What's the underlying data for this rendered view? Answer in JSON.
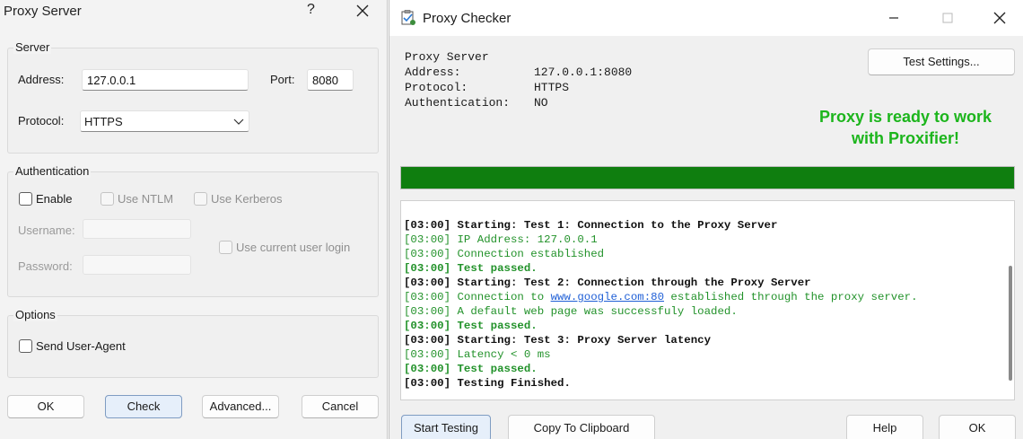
{
  "proxy_dialog": {
    "title": "Proxy Server",
    "help_glyph": "?",
    "server": {
      "legend": "Server",
      "address_label": "Address:",
      "address_value": "127.0.0.1",
      "port_label": "Port:",
      "port_value": "8080",
      "protocol_label": "Protocol:",
      "protocol_value": "HTTPS"
    },
    "authentication": {
      "legend": "Authentication",
      "enable_label": "Enable",
      "use_ntlm_label": "Use NTLM",
      "use_kerberos_label": "Use Kerberos",
      "username_label": "Username:",
      "password_label": "Password:",
      "use_current_user_label": "Use current user login"
    },
    "options": {
      "legend": "Options",
      "send_user_agent_label": "Send User-Agent"
    },
    "buttons": {
      "ok": "OK",
      "check": "Check",
      "advanced": "Advanced...",
      "cancel": "Cancel"
    }
  },
  "checker": {
    "title": "Proxy Checker",
    "info": {
      "heading": "Proxy Server",
      "address_label": "Address:",
      "address_value": "127.0.0.1:8080",
      "protocol_label": "Protocol:",
      "protocol_value": "HTTPS",
      "auth_label": "Authentication:",
      "auth_value": "NO"
    },
    "test_settings_label": "Test Settings...",
    "status_line1": "Proxy is ready to work",
    "status_line2": "with Proxifier!",
    "progress_percent": 100,
    "log": [
      {
        "text": "[03:00] Starting: Test 1: Connection to the Proxy Server",
        "style": "bold"
      },
      {
        "text": "[03:00] IP Address: 127.0.0.1",
        "style": "ok"
      },
      {
        "text": "[03:00] Connection established",
        "style": "ok"
      },
      {
        "text": "[03:00] Test passed.",
        "style": "passed"
      },
      {
        "text": "[03:00] Starting: Test 2: Connection through the Proxy Server",
        "style": "bold"
      },
      {
        "text_before": "[03:00] Connection to ",
        "link": "www.google.com:80",
        "text_after": " established through the proxy server.",
        "style": "ok"
      },
      {
        "text": "[03:00] A default web page was successfuly loaded.",
        "style": "ok"
      },
      {
        "text": "[03:00] Test passed.",
        "style": "passed"
      },
      {
        "text": "[03:00] Starting: Test 3: Proxy Server latency",
        "style": "bold"
      },
      {
        "text": "[03:00] Latency < 0 ms",
        "style": "ok"
      },
      {
        "text": "[03:00] Test passed.",
        "style": "passed"
      },
      {
        "text": "[03:00] Testing Finished.",
        "style": "bold"
      }
    ],
    "buttons": {
      "start_testing": "Start Testing",
      "copy_to_clipboard": "Copy To Clipboard",
      "help": "Help",
      "ok": "OK"
    }
  },
  "colors": {
    "status_green": "#1cb51c",
    "progress_green": "#0f7e0f",
    "log_green": "#22922a",
    "link_blue": "#1f5fd6"
  }
}
